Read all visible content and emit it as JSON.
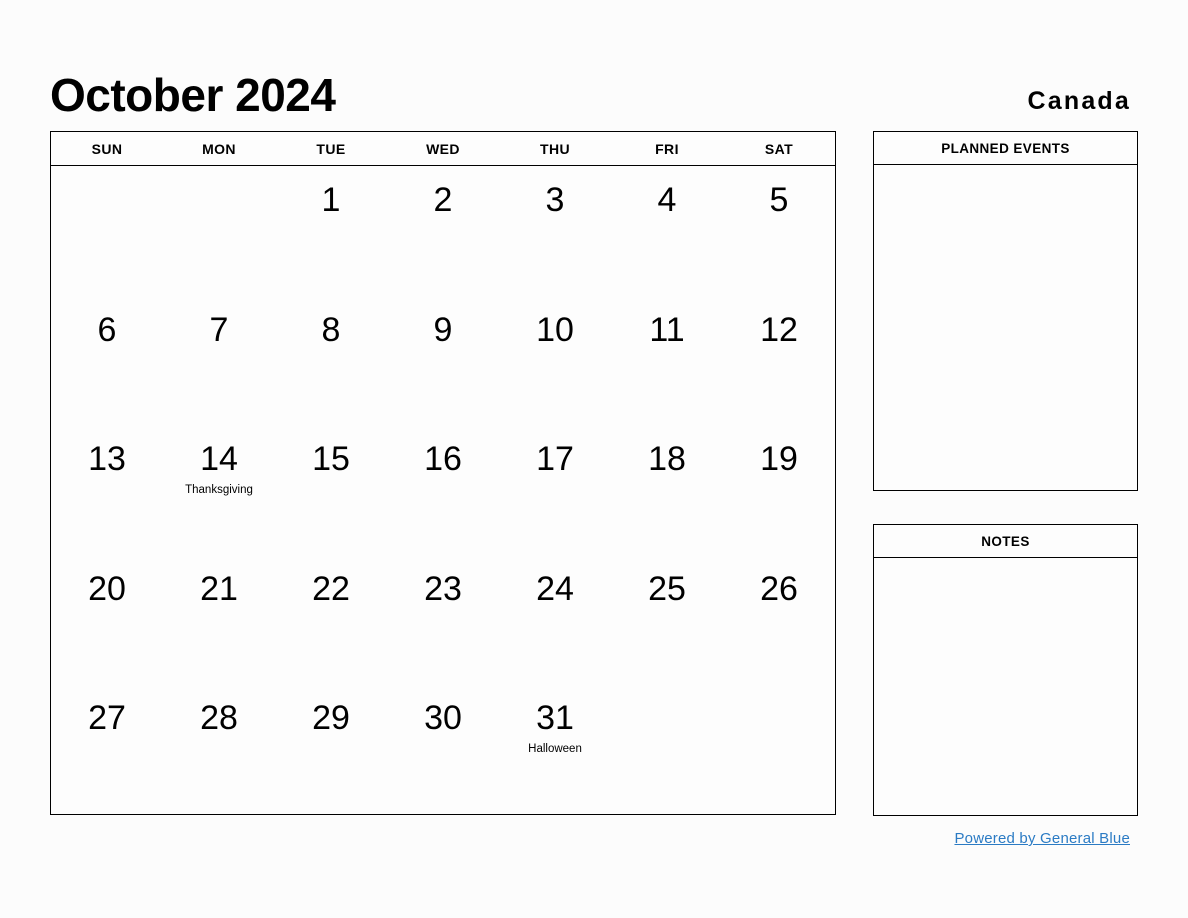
{
  "header": {
    "month_title": "October 2024",
    "region": "Canada"
  },
  "calendar": {
    "weekdays": [
      "SUN",
      "MON",
      "TUE",
      "WED",
      "THU",
      "FRI",
      "SAT"
    ],
    "weeks": [
      [
        {
          "day": "",
          "event": ""
        },
        {
          "day": "",
          "event": ""
        },
        {
          "day": "1",
          "event": ""
        },
        {
          "day": "2",
          "event": ""
        },
        {
          "day": "3",
          "event": ""
        },
        {
          "day": "4",
          "event": ""
        },
        {
          "day": "5",
          "event": ""
        }
      ],
      [
        {
          "day": "6",
          "event": ""
        },
        {
          "day": "7",
          "event": ""
        },
        {
          "day": "8",
          "event": ""
        },
        {
          "day": "9",
          "event": ""
        },
        {
          "day": "10",
          "event": ""
        },
        {
          "day": "11",
          "event": ""
        },
        {
          "day": "12",
          "event": ""
        }
      ],
      [
        {
          "day": "13",
          "event": ""
        },
        {
          "day": "14",
          "event": "Thanksgiving"
        },
        {
          "day": "15",
          "event": ""
        },
        {
          "day": "16",
          "event": ""
        },
        {
          "day": "17",
          "event": ""
        },
        {
          "day": "18",
          "event": ""
        },
        {
          "day": "19",
          "event": ""
        }
      ],
      [
        {
          "day": "20",
          "event": ""
        },
        {
          "day": "21",
          "event": ""
        },
        {
          "day": "22",
          "event": ""
        },
        {
          "day": "23",
          "event": ""
        },
        {
          "day": "24",
          "event": ""
        },
        {
          "day": "25",
          "event": ""
        },
        {
          "day": "26",
          "event": ""
        }
      ],
      [
        {
          "day": "27",
          "event": ""
        },
        {
          "day": "28",
          "event": ""
        },
        {
          "day": "29",
          "event": ""
        },
        {
          "day": "30",
          "event": ""
        },
        {
          "day": "31",
          "event": "Halloween"
        },
        {
          "day": "",
          "event": ""
        },
        {
          "day": "",
          "event": ""
        }
      ]
    ]
  },
  "panels": {
    "planned_events": {
      "title": "PLANNED EVENTS",
      "content": ""
    },
    "notes": {
      "title": "NOTES",
      "content": ""
    }
  },
  "footer": {
    "link_text": "Powered by General Blue",
    "link_color": "#2b7bc4"
  }
}
